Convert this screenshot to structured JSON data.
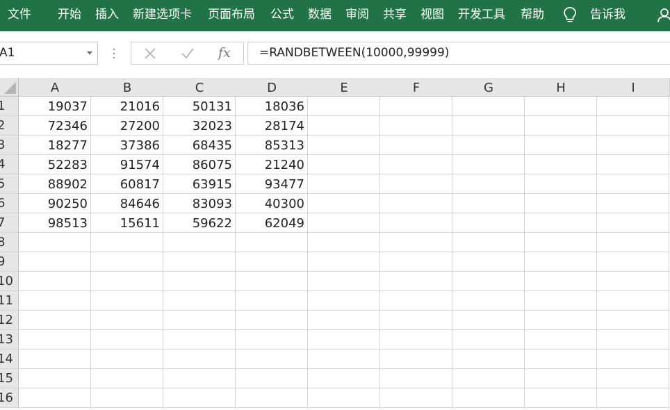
{
  "ribbon": {
    "background": "#217346",
    "tabs": [
      "文件",
      "开始",
      "插入",
      "新建选项卡",
      "页面布局",
      "公式",
      "数据",
      "审阅",
      "共享",
      "视图",
      "开发工具",
      "帮助"
    ],
    "tell_me_icon": "lightbulb-icon",
    "tell_me": "告诉我",
    "account_icon": "person-icon"
  },
  "formula_bar": {
    "name_box": "A1",
    "cancel_icon": "x-icon",
    "enter_icon": "check-icon",
    "fx_label": "fx",
    "formula": "=RANDBETWEEN(10000,99999)"
  },
  "sheet": {
    "columns": [
      "A",
      "B",
      "C",
      "D",
      "E",
      "F",
      "G",
      "H",
      "I"
    ],
    "row_numbers": [
      "1",
      "2",
      "3",
      "4",
      "5",
      "6",
      "7",
      "8",
      "9",
      "10",
      "11",
      "12",
      "13",
      "14",
      "15",
      "16"
    ],
    "rows": [
      [
        "19037",
        "21016",
        "50131",
        "18036"
      ],
      [
        "72346",
        "27200",
        "32023",
        "28174"
      ],
      [
        "18277",
        "37386",
        "68435",
        "85313"
      ],
      [
        "52283",
        "91574",
        "86075",
        "21240"
      ],
      [
        "88902",
        "60817",
        "63915",
        "93477"
      ],
      [
        "90250",
        "84646",
        "83093",
        "40300"
      ],
      [
        "98513",
        "15611",
        "59622",
        "62049"
      ]
    ]
  }
}
